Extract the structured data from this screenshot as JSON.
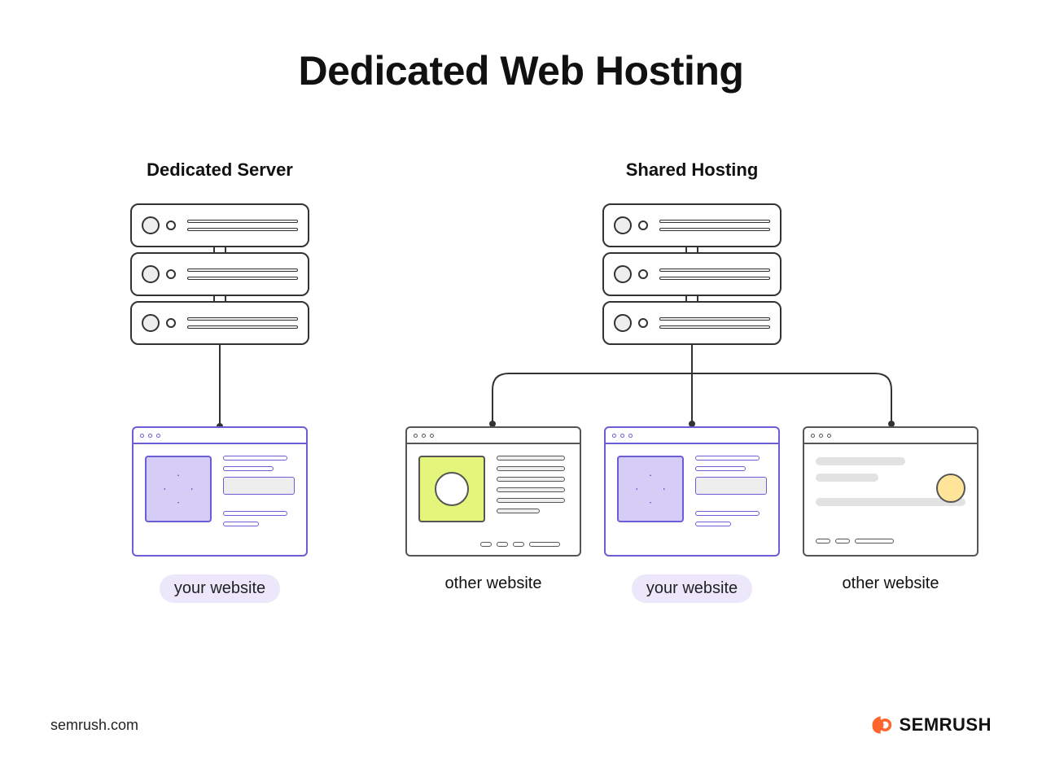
{
  "title": "Dedicated Web Hosting",
  "left": {
    "heading": "Dedicated Server",
    "site_label": "your website"
  },
  "right": {
    "heading": "Shared Hosting",
    "sites": [
      {
        "label": "other website",
        "highlighted": false
      },
      {
        "label": "your website",
        "highlighted": true
      },
      {
        "label": "other website",
        "highlighted": false
      }
    ]
  },
  "footer": {
    "url": "semrush.com",
    "brand": "SEMRUSH"
  }
}
